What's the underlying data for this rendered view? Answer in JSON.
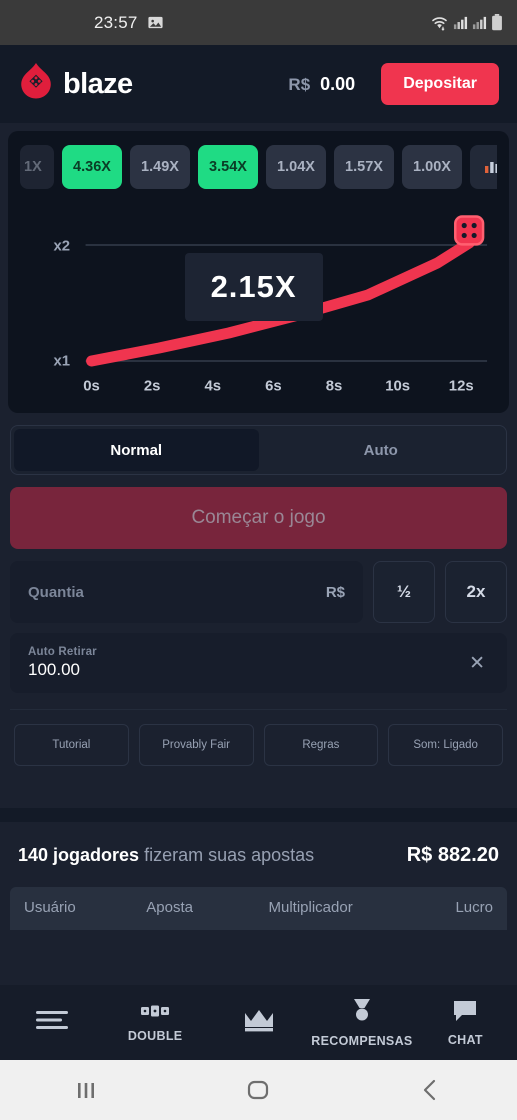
{
  "status_bar": {
    "time": "23:57",
    "icons": [
      "image-icon",
      "wifi-icon",
      "signal-icon",
      "signal-icon",
      "battery-icon"
    ]
  },
  "header": {
    "brand": "blaze",
    "currency": "R$",
    "balance": "0.00",
    "deposit_label": "Depositar"
  },
  "history": {
    "chips": [
      {
        "label": "1X",
        "state": "partial"
      },
      {
        "label": "4.36X",
        "state": "green"
      },
      {
        "label": "1.49X",
        "state": "normal"
      },
      {
        "label": "3.54X",
        "state": "green"
      },
      {
        "label": "1.04X",
        "state": "normal"
      },
      {
        "label": "1.57X",
        "state": "normal"
      },
      {
        "label": "1.00X",
        "state": "normal"
      }
    ],
    "stats_icon": "bar-chart-icon"
  },
  "chart_data": {
    "type": "line",
    "title": "",
    "current_multiplier": "2.15X",
    "x": [
      0,
      2,
      4,
      6,
      8,
      10,
      12
    ],
    "xlabel": "",
    "ylabel": "",
    "xtick_labels": [
      "0s",
      "2s",
      "4s",
      "6s",
      "8s",
      "10s",
      "12s"
    ],
    "ytick_labels": [
      "x1",
      "x2"
    ],
    "yticks": [
      1,
      2
    ],
    "ylim": [
      1,
      2.3
    ],
    "xlim": [
      0,
      13
    ],
    "series": [
      {
        "name": "multiplier-curve",
        "color": "#f0354f",
        "x": [
          0,
          2,
          4,
          6,
          8,
          10,
          12,
          13
        ],
        "values": [
          1.0,
          1.14,
          1.3,
          1.48,
          1.69,
          1.9,
          2.1,
          2.15
        ]
      }
    ],
    "marker": "dice-icon",
    "grid": true,
    "legend": "none"
  },
  "mode": {
    "tabs": [
      {
        "label": "Normal",
        "active": true
      },
      {
        "label": "Auto",
        "active": false
      }
    ]
  },
  "actions": {
    "start_label": "Começar o jogo"
  },
  "bet": {
    "amount_placeholder": "Quantia",
    "amount_currency": "R$",
    "half_label": "½",
    "double_label": "2x",
    "auto_label": "Auto Retirar",
    "auto_value": "100.00",
    "clear_icon": "close-icon"
  },
  "utilities": [
    {
      "label": "Tutorial"
    },
    {
      "label": "Provably Fair"
    },
    {
      "label": "Regras"
    },
    {
      "label": "Som: Ligado"
    }
  ],
  "players": {
    "count_text": "140 jogadores",
    "subtitle": " fizeram suas apostas",
    "total": "R$ 882.20",
    "columns": [
      "Usuário",
      "Aposta",
      "Multiplicador",
      "Lucro"
    ]
  },
  "bottom_nav": [
    {
      "label": "",
      "icon": "menu-icon"
    },
    {
      "label": "DOUBLE",
      "icon": "double-dice-icon"
    },
    {
      "label": "",
      "icon": "crown-icon"
    },
    {
      "label": "RECOMPENSAS",
      "icon": "medal-icon"
    },
    {
      "label": "CHAT",
      "icon": "chat-icon"
    }
  ],
  "android_nav": [
    {
      "icon": "recents-icon"
    },
    {
      "icon": "home-icon"
    },
    {
      "icon": "back-icon"
    }
  ],
  "colors": {
    "brand_red": "#f0354f",
    "green": "#1fdb84",
    "panel": "#0d131e",
    "page": "#1b212f"
  }
}
